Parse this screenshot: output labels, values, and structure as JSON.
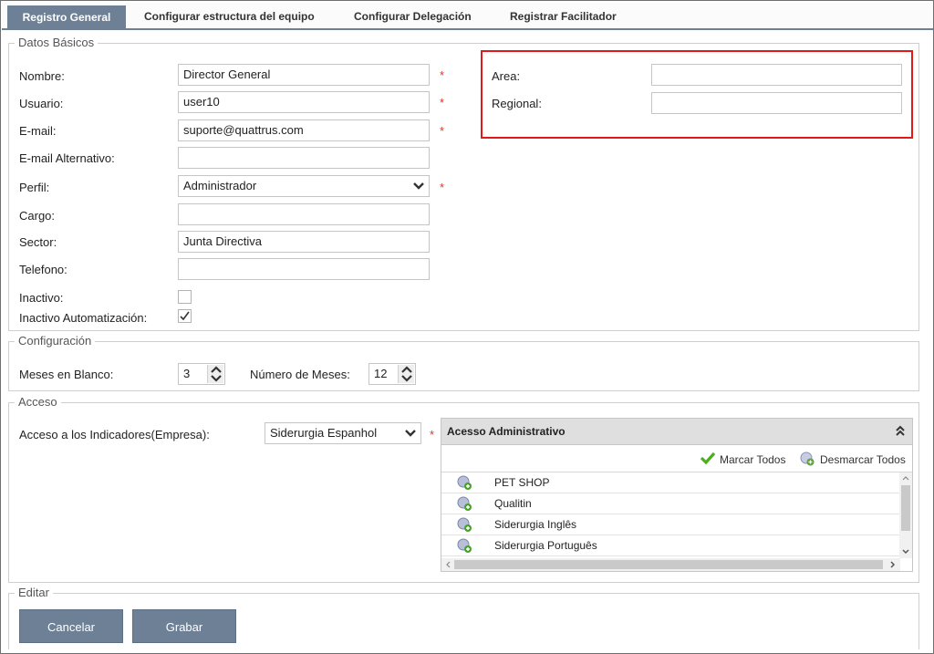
{
  "tabs": [
    {
      "label": "Registro General",
      "active": true
    },
    {
      "label": "Configurar estructura del equipo"
    },
    {
      "label": "Configurar Delegación"
    },
    {
      "label": "Registrar Facilitador"
    }
  ],
  "datos_basicos": {
    "legend": "Datos Básicos",
    "nombre": {
      "label": "Nombre:",
      "value": "Director General"
    },
    "usuario": {
      "label": "Usuario:",
      "value": "user10"
    },
    "email": {
      "label": "E-mail:",
      "value": "suporte@quattrus.com"
    },
    "email_alt": {
      "label": "E-mail Alternativo:",
      "value": ""
    },
    "perfil": {
      "label": "Perfil:",
      "value": "Administrador"
    },
    "cargo": {
      "label": "Cargo:",
      "value": ""
    },
    "sector": {
      "label": "Sector:",
      "value": "Junta Directiva"
    },
    "telefono": {
      "label": "Telefono:",
      "value": ""
    },
    "inactivo": {
      "label": "Inactivo:",
      "checked": false
    },
    "inactivo_auto": {
      "label": "Inactivo Automatización:",
      "checked": true
    },
    "area": {
      "label": "Area:",
      "value": ""
    },
    "regional": {
      "label": "Regional:",
      "value": ""
    },
    "required_mark": "*"
  },
  "configuracion": {
    "legend": "Configuración",
    "meses_blanco": {
      "label": "Meses en Blanco:",
      "value": "3"
    },
    "numero_meses": {
      "label": "Número de Meses:",
      "value": "12"
    }
  },
  "acceso": {
    "legend": "Acceso",
    "indicadores": {
      "label": "Acceso a los Indicadores(Empresa):",
      "value": "Siderurgia Espanhol"
    },
    "panel": {
      "title": "Acesso Administrativo",
      "marcar": "Marcar Todos",
      "desmarcar": "Desmarcar Todos",
      "items": [
        "PET SHOP",
        "Qualitin",
        "Siderurgia Inglês",
        "Siderurgia Português"
      ]
    }
  },
  "editar": {
    "legend": "Editar",
    "cancel": "Cancelar",
    "save": "Grabar"
  },
  "colors": {
    "accent": "#6d8096",
    "required": "#e0352b",
    "highlight": "#e01a1a",
    "check_green": "#4caf1e"
  }
}
